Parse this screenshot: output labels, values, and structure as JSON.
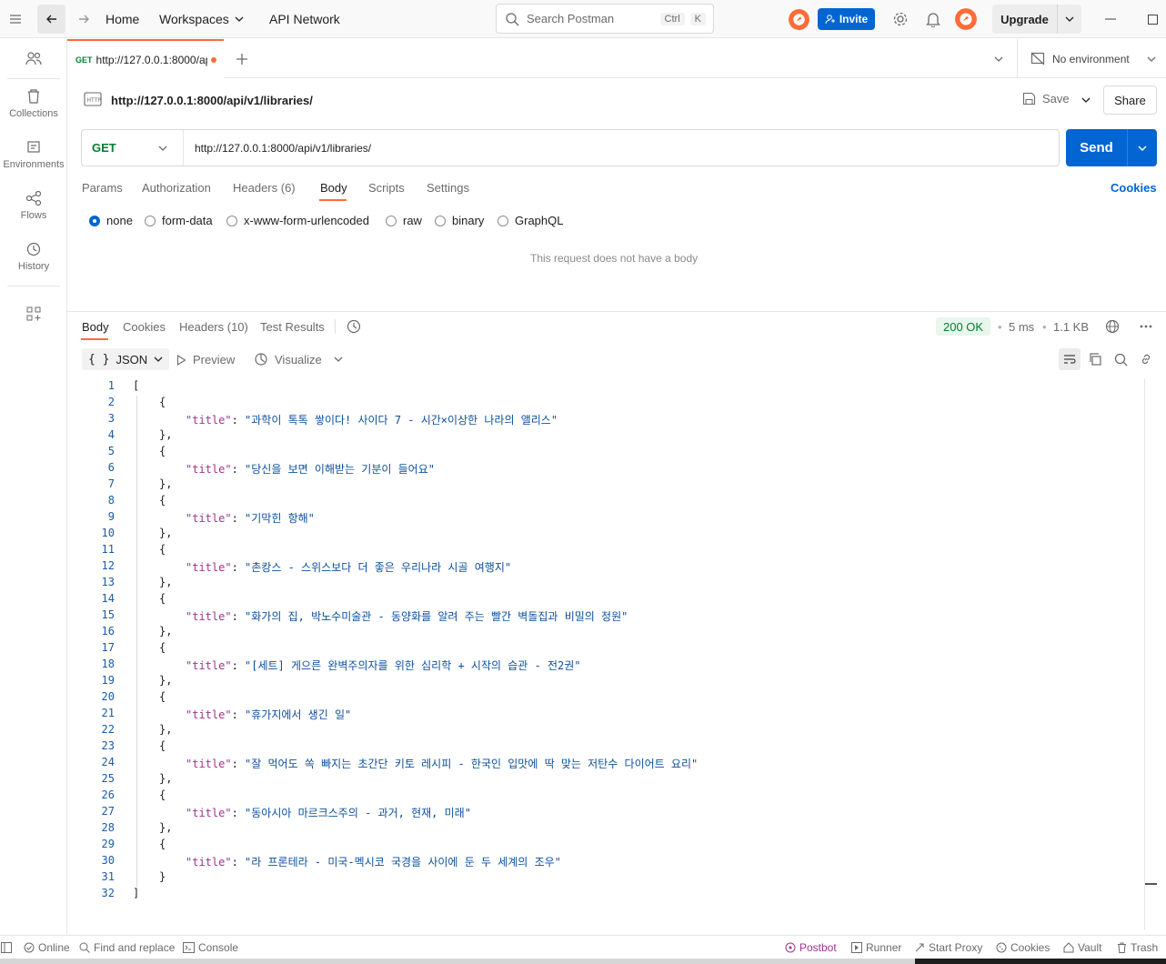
{
  "topbar": {
    "home": "Home",
    "workspaces": "Workspaces",
    "api_network": "API Network",
    "search_placeholder": "Search Postman",
    "kbd_ctrl": "Ctrl",
    "kbd_k": "K",
    "invite": "Invite",
    "upgrade": "Upgrade"
  },
  "sidebar": {
    "items": [
      {
        "label": "Collections"
      },
      {
        "label": "Environments"
      },
      {
        "label": "Flows"
      },
      {
        "label": "History"
      }
    ]
  },
  "tabs": {
    "active_method": "GET",
    "active_title": "http://127.0.0.1:8000/ap",
    "environment": "No environment"
  },
  "request": {
    "title": "http://127.0.0.1:8000/api/v1/libraries/",
    "save": "Save",
    "share": "Share",
    "method": "GET",
    "url": "http://127.0.0.1:8000/api/v1/libraries/",
    "send": "Send",
    "tabs": [
      "Params",
      "Authorization",
      "Headers (6)",
      "Body",
      "Scripts",
      "Settings"
    ],
    "cookies": "Cookies",
    "body_types": [
      "none",
      "form-data",
      "x-www-form-urlencoded",
      "raw",
      "binary",
      "GraphQL"
    ],
    "no_body": "This request does not have a body"
  },
  "response": {
    "tabs": [
      "Body",
      "Cookies",
      "Headers (10)",
      "Test Results"
    ],
    "status": "200 OK",
    "time": "5 ms",
    "size": "1.1 KB",
    "format": "JSON",
    "preview": "Preview",
    "visualize": "Visualize",
    "key": "title",
    "titles": [
      "과학이 톡톡 쌓이다! 사이다 7 - 시간×이상한 나라의 앨리스",
      "당신을 보면 이해받는 기분이 들어요",
      "기막힌 항해",
      "촌캉스 - 스위스보다 더 좋은 우리나라 시골 여행지",
      "화가의 집, 박노수미술관 - 동양화를 알려 주는 빨간 벽돌집과 비밀의 정원",
      "[세트] 게으른 완벽주의자를 위한 심리학 + 시작의 습관 - 전2권",
      "휴가지에서 생긴 일",
      "잘 먹어도 쏙 빠지는 초간단 키토 레시피 - 한국인 입맛에 딱 맞는 저탄수 다이어트 요리",
      "동아시아 마르크스주의 - 과거, 현재, 미래",
      "라 프론테라 - 미국-멕시코 국경을 사이에 둔 두 세계의 조우"
    ]
  },
  "statusbar": {
    "online": "Online",
    "find_replace": "Find and replace",
    "console": "Console",
    "postbot": "Postbot",
    "runner": "Runner",
    "start_proxy": "Start Proxy",
    "cookies": "Cookies",
    "vault": "Vault",
    "trash": "Trash"
  },
  "colors": {
    "accent": "#ff6c37",
    "primary": "#0265d2",
    "get_method": "#007f31",
    "status_ok": "#007f31"
  }
}
